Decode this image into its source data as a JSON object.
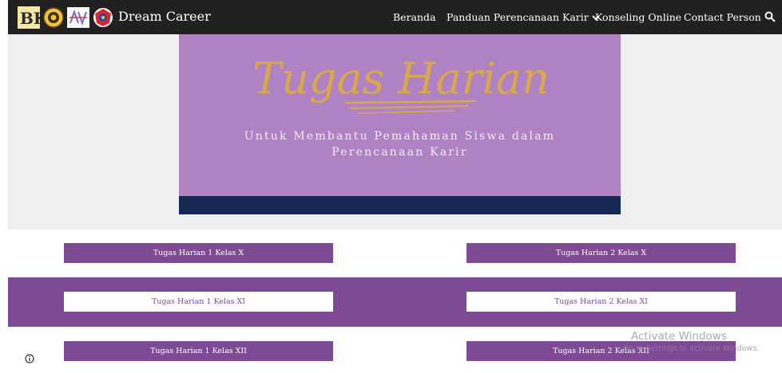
{
  "header": {
    "logos": [
      "bk-logo",
      "garuda-emblem-logo",
      "counseling-logo",
      "province-emblem-logo"
    ],
    "bk_text": "BK",
    "site_title": "Dream Career",
    "nav": {
      "beranda": "Beranda",
      "panduan": "Panduan Perencanaan Karir",
      "konseling": "Konseling Online",
      "contact": "Contact Person"
    }
  },
  "banner": {
    "script_title": "Tugas Harian",
    "subtitle_line1": "Untuk Membantu Pemahaman Siswa dalam",
    "subtitle_line2": "Perencanaan Karir"
  },
  "buttons": {
    "h1_x": "Tugas Harian 1 Kelas X",
    "h2_x": "Tugas Harian 2 Kelas X",
    "h1_xi": "Tugas Harian 1 Kelas XI",
    "h2_xi": "Tugas Harian 2 Kelas XI",
    "h1_xii": "Tugas Harian 1 Kelas XII",
    "h2_xii": "Tugas Harian 2 Kelas XII"
  },
  "watermark": {
    "title": "Activate Windows",
    "subtitle": "Go to Settings to activate Windows."
  },
  "colors": {
    "accent_purple": "#7e4a94",
    "banner_purple": "#af82c3",
    "banner_navy": "#162955",
    "gold": "#d9a84a",
    "nav_bg": "#212121"
  }
}
